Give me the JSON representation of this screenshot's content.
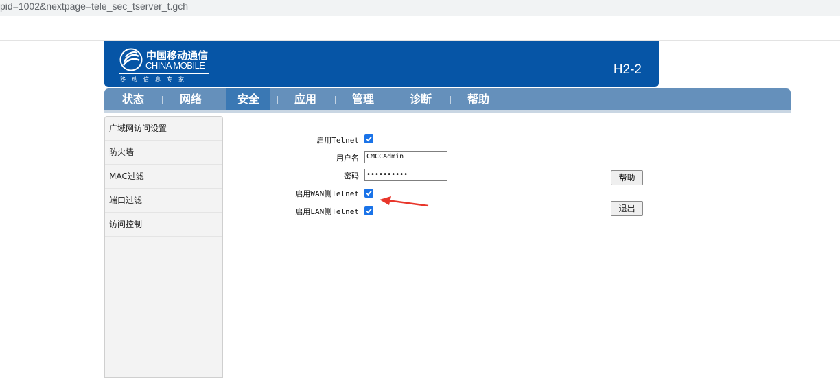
{
  "browser": {
    "url_fragment": "pid=1002&nextpage=tele_sec_tserver_t.gch"
  },
  "header": {
    "logo_cn": "中国移动通信",
    "logo_en": "CHINA MOBILE",
    "logo_slogan": "移动信息专家",
    "model": "H2-2",
    "brand_color": "#0655a6"
  },
  "nav": {
    "items": [
      "状态",
      "网络",
      "安全",
      "应用",
      "管理",
      "诊断",
      "帮助"
    ],
    "active": "安全",
    "bar_color": "#6590bb",
    "active_color": "#3a78b4"
  },
  "sidebar": {
    "items": [
      "广域网访问设置",
      "防火墙",
      "MAC过滤",
      "端口过滤",
      "访问控制"
    ]
  },
  "form": {
    "enable_telnet_label": "启用Telnet",
    "enable_telnet_checked": true,
    "username_label": "用户名",
    "username_value": "CMCCAdmin",
    "password_label": "密码",
    "password_value": "••••••••••",
    "wan_telnet_label": "启用WAN侧Telnet",
    "wan_telnet_checked": true,
    "lan_telnet_label": "启用LAN侧Telnet",
    "lan_telnet_checked": true,
    "checkbox_color": "#1a73e8"
  },
  "buttons": {
    "help": "帮助",
    "logout": "退出"
  },
  "annotation": {
    "arrow_color": "#e8362b"
  }
}
